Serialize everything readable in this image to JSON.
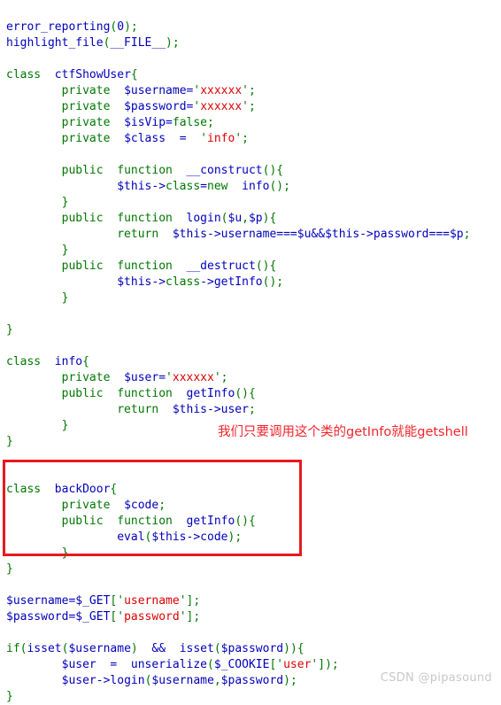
{
  "document": {
    "kind": "php-source-listing",
    "background_color": "#ffffff"
  },
  "colors": {
    "keyword": "#007700",
    "variable": "#0000BB",
    "string": "#DD0000",
    "punctuation": "#007700",
    "annotation_red": "#F2252B",
    "box_red": "#E8191E",
    "watermark_gray": "#C8C8C8"
  },
  "code": {
    "lines": [
      {
        "id": "line-1",
        "text": "error_reporting(0);"
      },
      {
        "id": "line-2",
        "text": "highlight_file(__FILE__);"
      },
      {
        "id": "line-3",
        "text": ""
      },
      {
        "id": "line-4",
        "text": "class  ctfShowUser{"
      },
      {
        "id": "line-5",
        "text": "        private  $username='xxxxxx';"
      },
      {
        "id": "line-6",
        "text": "        private  $password='xxxxxx';"
      },
      {
        "id": "line-7",
        "text": "        private  $isVip=false;"
      },
      {
        "id": "line-8",
        "text": "        private  $class  =  'info';"
      },
      {
        "id": "line-9",
        "text": ""
      },
      {
        "id": "line-10",
        "text": "        public  function  __construct(){"
      },
      {
        "id": "line-11",
        "text": "                $this->class=new  info();"
      },
      {
        "id": "line-12",
        "text": "        }"
      },
      {
        "id": "line-13",
        "text": "        public  function  login($u,$p){"
      },
      {
        "id": "line-14",
        "text": "                return  $this->username===$u&&$this->password===$p;"
      },
      {
        "id": "line-15",
        "text": "        }"
      },
      {
        "id": "line-16",
        "text": "        public  function  __destruct(){"
      },
      {
        "id": "line-17",
        "text": "                $this->class->getInfo();"
      },
      {
        "id": "line-18",
        "text": "        }"
      },
      {
        "id": "line-19",
        "text": ""
      },
      {
        "id": "line-20",
        "text": "}"
      },
      {
        "id": "line-21",
        "text": ""
      },
      {
        "id": "line-22",
        "text": "class  info{"
      },
      {
        "id": "line-23",
        "text": "        private  $user='xxxxxx';"
      },
      {
        "id": "line-24",
        "text": "        public  function  getInfo(){"
      },
      {
        "id": "line-25",
        "text": "                return  $this->user;"
      },
      {
        "id": "line-26",
        "text": "        }"
      },
      {
        "id": "line-27",
        "text": "}"
      },
      {
        "id": "line-28",
        "text": ""
      },
      {
        "id": "line-29",
        "text": ""
      },
      {
        "id": "line-30",
        "text": "class  backDoor{"
      },
      {
        "id": "line-31",
        "text": "        private  $code;"
      },
      {
        "id": "line-32",
        "text": "        public  function  getInfo(){"
      },
      {
        "id": "line-33",
        "text": "                eval($this->code);"
      },
      {
        "id": "line-34",
        "text": "        }"
      },
      {
        "id": "line-35",
        "text": "}"
      },
      {
        "id": "line-36",
        "text": ""
      },
      {
        "id": "line-37",
        "text": "$username=$_GET['username'];"
      },
      {
        "id": "line-38",
        "text": "$password=$_GET['password'];"
      },
      {
        "id": "line-39",
        "text": ""
      },
      {
        "id": "line-40",
        "text": "if(isset($username)  &&  isset($password)){"
      },
      {
        "id": "line-41",
        "text": "        $user  =  unserialize($_COOKIE['user']);"
      },
      {
        "id": "line-42",
        "text": "        $user->login($username,$password);"
      },
      {
        "id": "line-43",
        "text": "}"
      }
    ]
  },
  "annotation": {
    "note_text": "我们只要调用这个类的getInfo就能getshell"
  },
  "watermark": {
    "text": "CSDN @pipasound"
  }
}
